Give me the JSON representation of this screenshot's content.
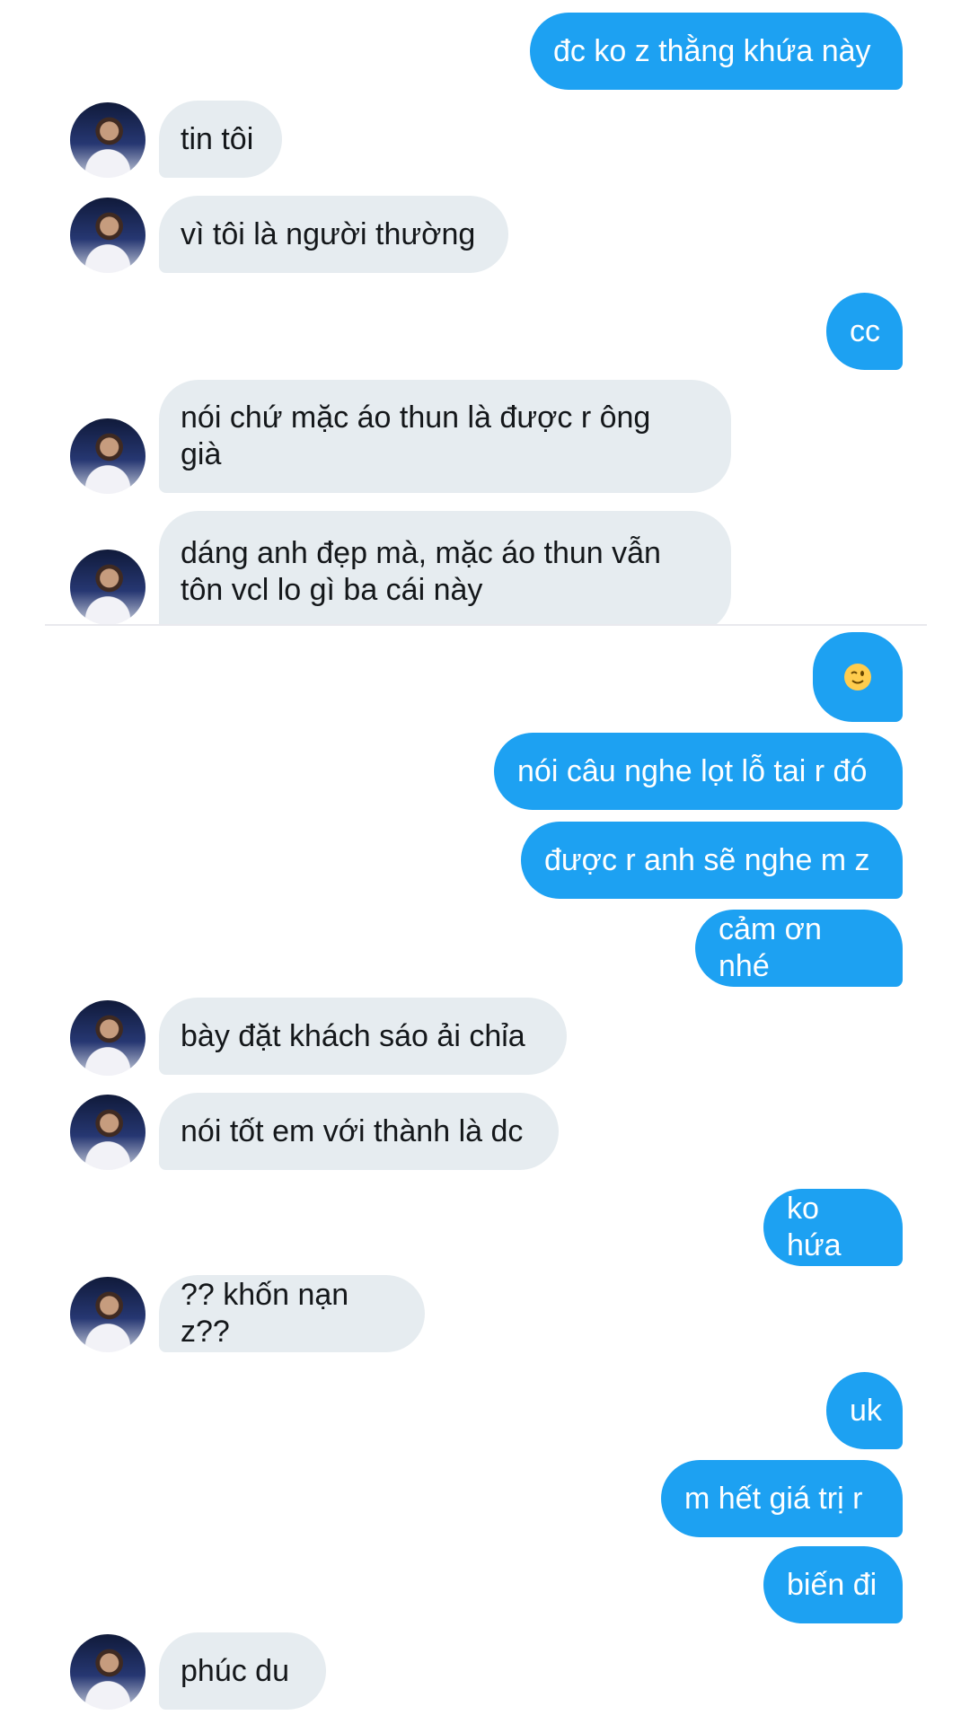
{
  "messages": [
    {
      "side": "out",
      "text": "đc ko z thằng khứa này"
    },
    {
      "side": "in",
      "text": "tin tôi"
    },
    {
      "side": "in",
      "text": "vì tôi là người thường"
    },
    {
      "side": "out",
      "text": "cc"
    },
    {
      "side": "in",
      "text": "nói chứ mặc áo thun là được r ông\ngià"
    },
    {
      "side": "in",
      "text": "dáng anh đẹp mà, mặc áo thun vẫn\ntôn vcl lo gì ba cái này"
    },
    {
      "side": "out",
      "text": "",
      "emoji": "winking-face"
    },
    {
      "side": "out",
      "text": "nói câu nghe lọt lỗ tai r đó"
    },
    {
      "side": "out",
      "text": "được r anh sẽ nghe m z"
    },
    {
      "side": "out",
      "text": "cảm ơn nhé"
    },
    {
      "side": "in",
      "text": " bày đặt khách sáo ải chỉa"
    },
    {
      "side": "in",
      "text": "nói tốt em với thành là dc"
    },
    {
      "side": "out",
      "text": "ko hứa"
    },
    {
      "side": "in",
      "text": "?? khốn nạn z??"
    },
    {
      "side": "out",
      "text": "uk"
    },
    {
      "side": "out",
      "text": "m hết giá trị r"
    },
    {
      "side": "out",
      "text": "biến đi"
    },
    {
      "side": "in",
      "text": "phúc du"
    }
  ],
  "colors": {
    "outgoing_bubble": "#1da1f2",
    "incoming_bubble": "#e6ecf0",
    "incoming_text": "#14171a",
    "outgoing_text": "#ffffff"
  },
  "avatar": {
    "icon": "basketball-player-avatar"
  }
}
